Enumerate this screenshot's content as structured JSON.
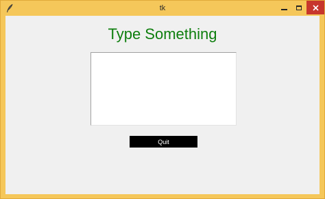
{
  "window": {
    "title": "tk",
    "frame_color": "#f5c75a",
    "close_color": "#c7362c"
  },
  "main": {
    "heading": "Type Something",
    "heading_color": "#0d7e0d",
    "text_area_value": "",
    "quit_label": "Quit"
  }
}
